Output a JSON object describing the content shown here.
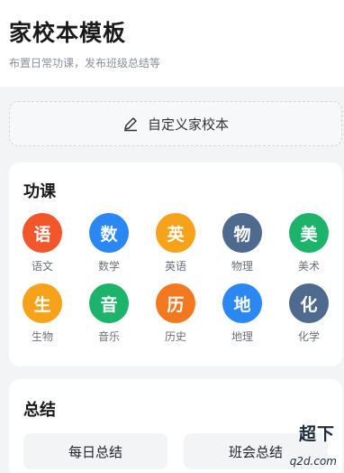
{
  "header": {
    "title": "家校本模板",
    "subtitle": "布置日常功课，发布班级总结等"
  },
  "custom_button": {
    "label": "自定义家校本",
    "icon": "pencil-icon"
  },
  "subjects_section": {
    "title": "功课",
    "items": [
      {
        "glyph": "语",
        "label": "语文",
        "color": "#f4562c"
      },
      {
        "glyph": "数",
        "label": "数学",
        "color": "#2b87f2"
      },
      {
        "glyph": "英",
        "label": "英语",
        "color": "#f7a21b"
      },
      {
        "glyph": "物",
        "label": "物理",
        "color": "#4e6a8e"
      },
      {
        "glyph": "美",
        "label": "美术",
        "color": "#1db36b"
      },
      {
        "glyph": "生",
        "label": "生物",
        "color": "#f7a21b"
      },
      {
        "glyph": "音",
        "label": "音乐",
        "color": "#1db36b"
      },
      {
        "glyph": "历",
        "label": "历史",
        "color": "#f4781f"
      },
      {
        "glyph": "地",
        "label": "地理",
        "color": "#2b87f2"
      },
      {
        "glyph": "化",
        "label": "化学",
        "color": "#4e6a8e"
      }
    ]
  },
  "summary_section": {
    "title": "总结",
    "buttons": [
      "每日总结",
      "班会总结"
    ]
  },
  "watermark": {
    "top": "超下",
    "bottom": "q2d.com"
  }
}
